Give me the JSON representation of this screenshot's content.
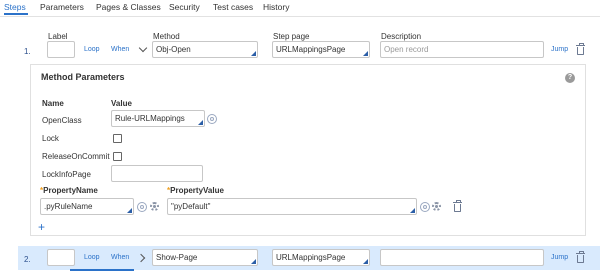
{
  "tabs": [
    "Steps",
    "Parameters",
    "Pages & Classes",
    "Security",
    "Test cases",
    "History"
  ],
  "columns": {
    "label": "Label",
    "method": "Method",
    "step_page": "Step page",
    "description": "Description"
  },
  "steps": [
    {
      "number": "1.",
      "label": "",
      "loop": "Loop",
      "when": "When",
      "method": "Obj-Open",
      "step_page": "URLMappingsPage",
      "description_placeholder": "Open record",
      "jump": "Jump"
    },
    {
      "number": "2.",
      "label": "",
      "loop": "Loop",
      "when": "When",
      "method": "Show-Page",
      "step_page": "URLMappingsPage",
      "description": "",
      "jump": "Jump"
    }
  ],
  "method_parameters": {
    "title": "Method Parameters",
    "name_header": "Name",
    "value_header": "Value",
    "open_class_label": "OpenClass",
    "open_class_value": "Rule-URLMappings",
    "lock_label": "Lock",
    "release_label": "ReleaseOnCommit",
    "lock_info_label": "LockInfoPage",
    "lock_info_value": "",
    "property_name_header": "PropertyName",
    "property_value_header": "PropertyValue",
    "property_name_value": ".pyRuleName",
    "property_value_value": "\"pyDefault\"",
    "required_marker": "*",
    "help": "?",
    "add": "+"
  },
  "colors": {
    "accent": "#2b72c9",
    "row_highlight": "#d9eafd",
    "required": "#f0a020"
  }
}
